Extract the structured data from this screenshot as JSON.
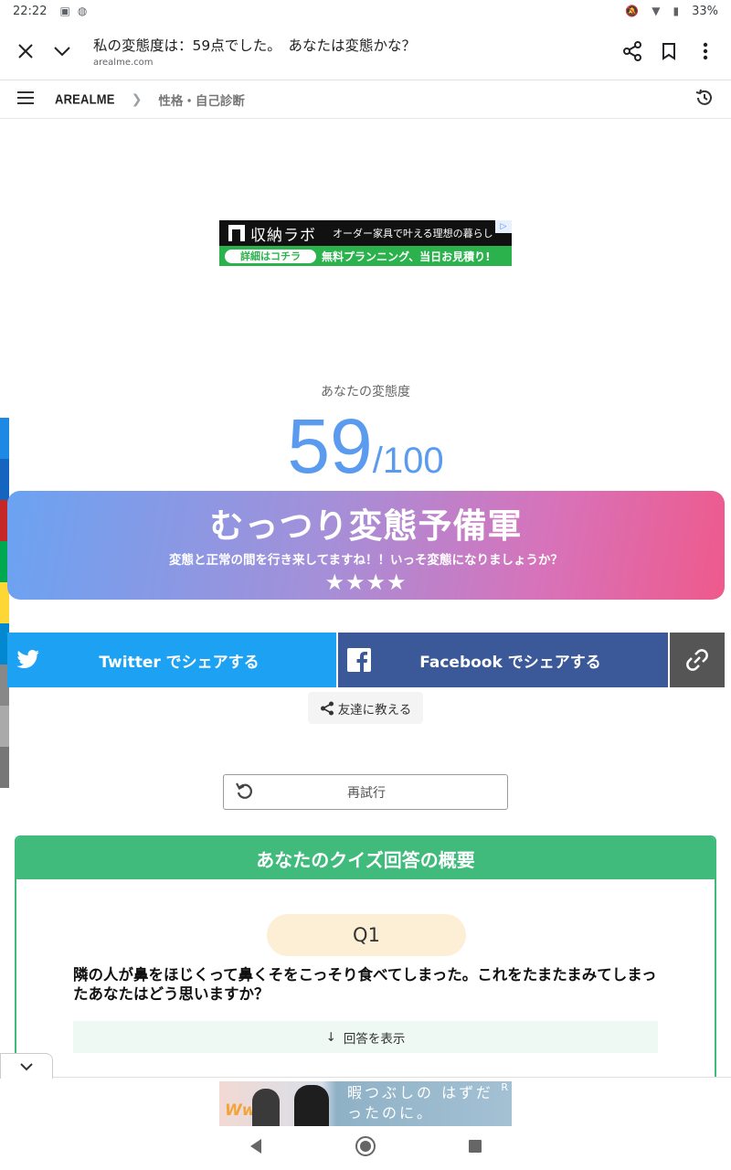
{
  "status_bar": {
    "time": "22:22",
    "battery": "33%"
  },
  "toolbar": {
    "page_title": "私の変態度は：59点でした。　あなたは変態かな？",
    "domain": "arealme.com"
  },
  "site_nav": {
    "brand": "AREALME",
    "breadcrumb": "性格・自己診断"
  },
  "top_ad": {
    "brand": "収納ラボ",
    "tagline": "オーダー家具で叶える理想の暮らし",
    "cta": "詳細はコチラ",
    "promo": "無料プランニング、当日お見積り!"
  },
  "result": {
    "label": "あなたの変態度",
    "score": "59",
    "out_of": "/100",
    "title": "むっつり変態予備軍",
    "subtitle": "変態と正常の間を行き来してますね！！いっそ変態になりましょうか？",
    "stars": "★★★★"
  },
  "share": {
    "twitter": "Twitter でシェアする",
    "facebook": "Facebook でシェアする",
    "tell_friends": "友達に教える"
  },
  "retry": {
    "label": "再試行"
  },
  "summary": {
    "heading": "あなたのクイズ回答の概要",
    "question_number": "Q1",
    "question_text": "隣の人が鼻をほじくって鼻くそをこっそり食べてしまった。これをたまたまみてしまったあなたはどう思いますか？",
    "show_answer": "回答を表示",
    "show_answer_arrow": "↓"
  },
  "bottom_ad": {
    "logo": "Ww",
    "copy": "暇つぶしの はずだったのに。",
    "badge": "R"
  },
  "colors": {
    "accent_blue": "#5a9bf0",
    "twitter": "#1da1f2",
    "facebook": "#3b5998",
    "summary_green": "#40bb7c",
    "strip": [
      "#1e88e5",
      "#1565c0",
      "#c62828",
      "#00a94f",
      "#fdd835",
      "#0288d1",
      "#888888",
      "#aaaaaa",
      "#777777"
    ]
  },
  "icons": [
    "close-icon",
    "chevron-down-icon",
    "share-icon",
    "bookmark-icon",
    "more-vert-icon",
    "menu-icon",
    "history-icon",
    "twitter-icon",
    "facebook-icon",
    "link-icon",
    "share-nodes-icon",
    "retry-icon"
  ]
}
